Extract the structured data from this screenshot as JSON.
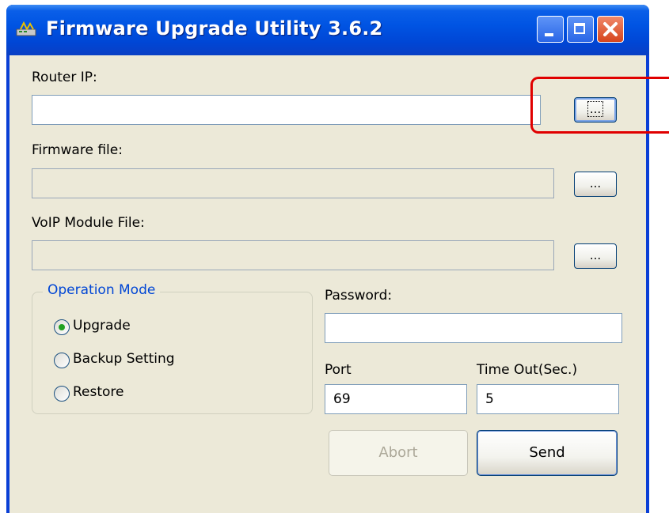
{
  "window": {
    "title": "Firmware Upgrade Utility 3.6.2",
    "controls": [
      "minimize-icon",
      "maximize-icon",
      "close-icon"
    ]
  },
  "form": {
    "router_ip": {
      "label": "Router IP:",
      "value": "",
      "browse_label": "..."
    },
    "firmware_file": {
      "label": "Firmware file:",
      "value": "",
      "browse_label": "..."
    },
    "voip_file": {
      "label": "VoIP Module File:",
      "value": "",
      "browse_label": "..."
    },
    "operation_mode": {
      "title": "Operation Mode",
      "options": [
        {
          "label": "Upgrade",
          "checked": true
        },
        {
          "label": "Backup Setting",
          "checked": false
        },
        {
          "label": "Restore",
          "checked": false
        }
      ]
    },
    "password": {
      "label": "Password:",
      "value": ""
    },
    "port": {
      "label": "Port",
      "value": "69"
    },
    "timeout": {
      "label": "Time Out(Sec.)",
      "value": "5"
    },
    "abort_label": "Abort",
    "send_label": "Send"
  },
  "colors": {
    "highlight": "#e00000",
    "titlebar": "#0054e3",
    "group_title": "#0046d5"
  }
}
